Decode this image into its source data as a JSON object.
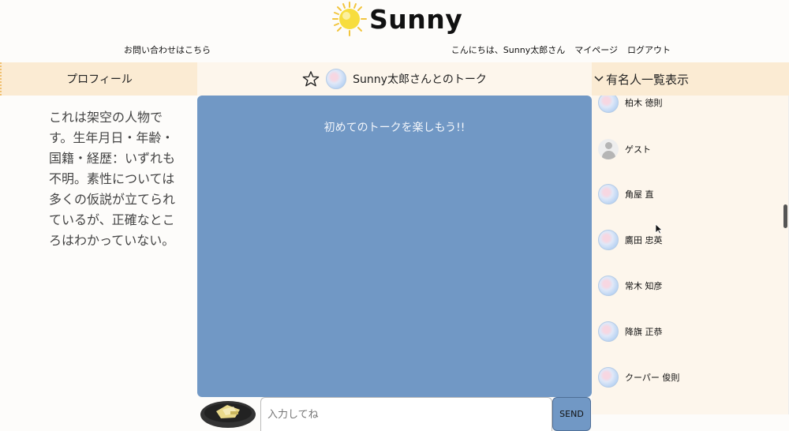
{
  "header": {
    "logo_text": "Sunny",
    "contact_link": "お問い合わせはこちら",
    "greeting": "こんにちは、Sunny太郎さん",
    "mypage_link": "マイページ",
    "logout_link": "ログアウト"
  },
  "profile": {
    "title": "プロフィール",
    "description": "これは架空の人物です。生年月日・年齢・国籍・経歴：いずれも不明。素性については多くの仮説が立てられているが、正確なところはわかっていない。"
  },
  "talk": {
    "title": "Sunny太郎さんとのトーク",
    "hint": "初めてのトークを楽しもう!!",
    "input_placeholder": "入力してね",
    "send_label": "SEND"
  },
  "celebrities": {
    "title": "有名人一覧表示",
    "items": [
      {
        "name": "柏木 徳則",
        "avatar": "photo"
      },
      {
        "name": "ゲスト",
        "avatar": "guest"
      },
      {
        "name": "角屋 直",
        "avatar": "photo"
      },
      {
        "name": "鷹田 忠英",
        "avatar": "photo"
      },
      {
        "name": "常木 知彦",
        "avatar": "photo"
      },
      {
        "name": "降旗 正恭",
        "avatar": "photo"
      },
      {
        "name": "クーパー 俊則",
        "avatar": "photo"
      }
    ]
  },
  "colors": {
    "talk_background": "#7198c5",
    "panel_header": "#fbebd3",
    "panel_body": "#fdf6ec"
  }
}
